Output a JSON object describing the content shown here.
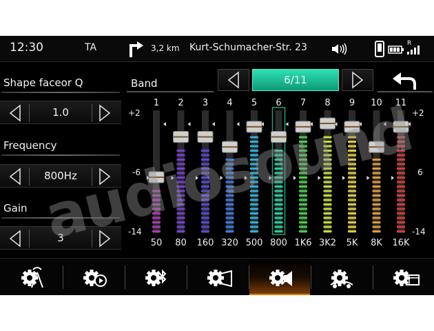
{
  "status": {
    "clock": "12:30",
    "ta": "TA",
    "distance": "3,2 km",
    "street": "Kurt-Schumacher-Str. 23",
    "icons": [
      "turn-right-icon",
      "volume-icon",
      "phone-icon",
      "battery-icon",
      "signal-icon"
    ],
    "signal_letter": "R"
  },
  "params": [
    {
      "label": "Shape faceor Q",
      "value": "1.0"
    },
    {
      "label": "Frequency",
      "value": "800Hz"
    },
    {
      "label": "Gain",
      "value": "3"
    }
  ],
  "band": {
    "label": "Band",
    "position": "6/11",
    "selected_index": 6
  },
  "eq": {
    "scale_top": "+2",
    "scale_mid": "-6",
    "scale_bottom": "-14",
    "scale_top_right": "+2",
    "scale_mid_right": "6",
    "scale_bottom_right": "-14",
    "band_numbers": [
      "1",
      "2",
      "3",
      "4",
      "5",
      "6",
      "7",
      "8",
      "9",
      "10",
      "11"
    ],
    "freq_labels": [
      "50",
      "80",
      "160",
      "320",
      "500",
      "800",
      "1K6",
      "3K2",
      "5K",
      "8K",
      "16K"
    ],
    "levels": [
      -6,
      0,
      0,
      -1.5,
      1.5,
      0,
      1.5,
      2,
      1.5,
      -1.5,
      1.5
    ],
    "range": [
      -14,
      2
    ],
    "colors": [
      "#b03ab8",
      "#7a3fe0",
      "#5a48e8",
      "#3c7cf0",
      "#2ab8e8",
      "#22d8a8",
      "#44d848",
      "#c8e83a",
      "#e8d23a",
      "#e8a03a",
      "#e03a3a"
    ]
  },
  "watermark": "audiosound",
  "toolbar": {
    "items": [
      "speaker-tower-gear-icon",
      "gear-play-icon",
      "gear-bluetooth-icon",
      "gear-screen-icon",
      "gear-speaker-icon",
      "gear-car-icon",
      "gear-display-icon"
    ],
    "active_index": 4,
    "active_color": "#e07a12"
  }
}
